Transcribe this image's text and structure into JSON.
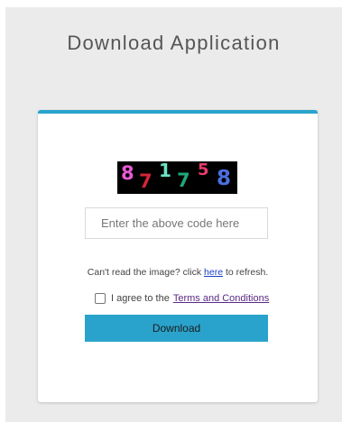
{
  "page": {
    "title": "Download Application"
  },
  "captcha": {
    "code": "871758",
    "digits": [
      {
        "char": "8",
        "color": "#e85ad6"
      },
      {
        "char": "7",
        "color": "#d3263a"
      },
      {
        "char": "1",
        "color": "#6fe3c7"
      },
      {
        "char": "7",
        "color": "#1fa87a"
      },
      {
        "char": "5",
        "color": "#e83b6b"
      },
      {
        "char": "8",
        "color": "#4c6fe0"
      }
    ]
  },
  "form": {
    "code_placeholder": "Enter the above code here",
    "code_value": "",
    "hint_prefix": "Can't read the image? click ",
    "hint_link": "here",
    "hint_suffix": " to refresh.",
    "agree_prefix": "I agree to the",
    "terms_link": "Terms and Conditions",
    "agree_checked": false,
    "download_label": "Download"
  },
  "colors": {
    "accent": "#2aa3cc",
    "background": "#ebebeb"
  }
}
